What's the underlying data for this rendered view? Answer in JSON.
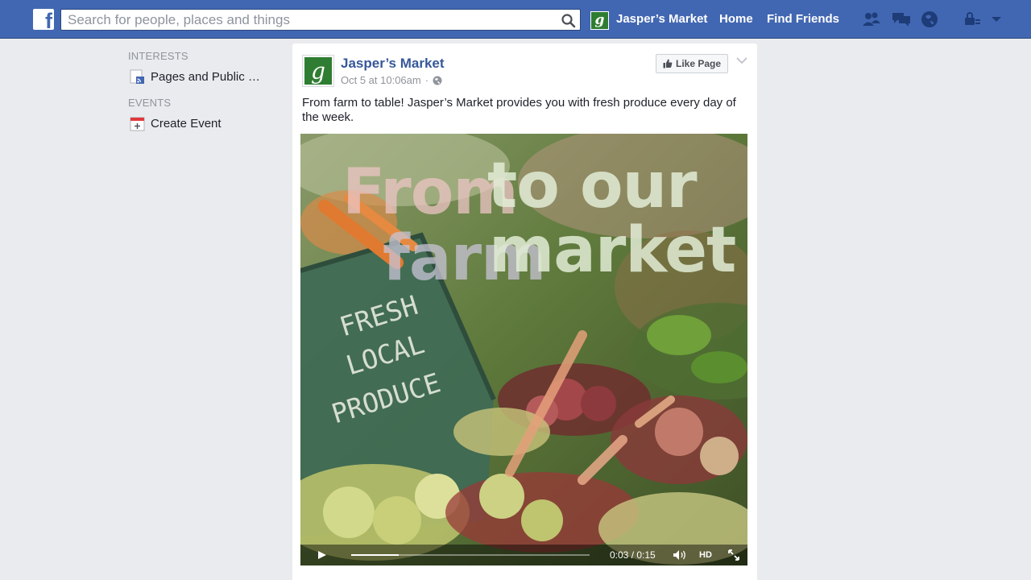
{
  "topbar": {
    "search_placeholder": "Search for people, places and things",
    "page_shortcut": "Jasper’s Market",
    "nav_home": "Home",
    "nav_find_friends": "Find Friends",
    "brand_color": "#4267b2"
  },
  "sidebar": {
    "interests_heading": "INTERESTS",
    "interests_item": "Pages and Public …",
    "events_heading": "EVENTS",
    "events_item": "Create Event"
  },
  "post": {
    "page_name": "Jasper’s Market",
    "timestamp": "Oct 5 at 10:06am",
    "separator": "·",
    "like_button": "Like Page",
    "text": "From farm to table! Jasper’s Market provides you with fresh produce every day of the week.",
    "video": {
      "overlay_line1_a": "From",
      "overlay_line1_b": "to our",
      "overlay_line2_a": "farm",
      "overlay_line2_b": "market",
      "sign_line1": "FRESH",
      "sign_line2": "LOCAL",
      "sign_line3": "PRODUCE",
      "time": "0:03 / 0:15",
      "hd": "HD",
      "progress": 0.2
    }
  }
}
